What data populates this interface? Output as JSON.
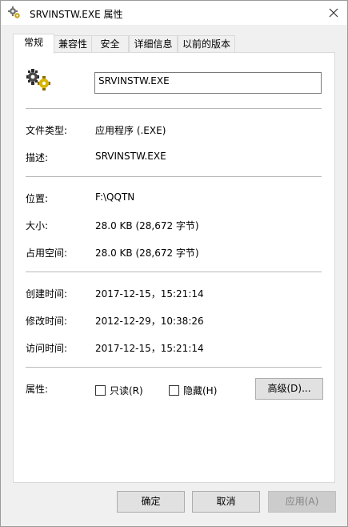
{
  "window": {
    "title": "SRVINSTW.EXE 属性",
    "close_label": "✕"
  },
  "tabs": [
    {
      "label": "常规",
      "active": true
    },
    {
      "label": "兼容性",
      "active": false
    },
    {
      "label": "安全",
      "active": false
    },
    {
      "label": "详细信息",
      "active": false
    },
    {
      "label": "以前的版本",
      "active": false
    }
  ],
  "general": {
    "file_name": "SRVINSTW.EXE",
    "file_type_label": "文件类型:",
    "file_type_value": "应用程序 (.EXE)",
    "description_label": "描述:",
    "description_value": "SRVINSTW.EXE",
    "location_label": "位置:",
    "location_value": "F:\\QQTN",
    "size_label": "大小:",
    "size_value": "28.0 KB (28,672 字节)",
    "size_on_disk_label": "占用空间:",
    "size_on_disk_value": "28.0 KB (28,672 字节)",
    "created_label": "创建时间:",
    "created_value": "2017-12-15，15:21:14",
    "modified_label": "修改时间:",
    "modified_value": "2012-12-29，10:38:26",
    "accessed_label": "访问时间:",
    "accessed_value": "2017-12-15，15:21:14",
    "attributes_label": "属性:",
    "readonly_label": "只读(R)",
    "readonly_checked": false,
    "hidden_label": "隐藏(H)",
    "hidden_checked": false,
    "advanced_button": "高级(D)..."
  },
  "footer": {
    "ok_button": "确定",
    "cancel_button": "取消",
    "apply_button": "应用(A)"
  },
  "colors": {
    "window_bg": "#f0f0f0",
    "panel_bg": "#ffffff",
    "button_bg": "#e1e1e1"
  }
}
